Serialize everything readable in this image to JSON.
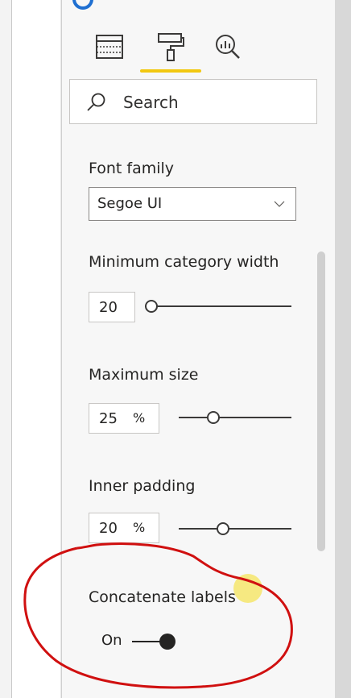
{
  "tabs": [
    {
      "name": "fields",
      "icon": "table-icon"
    },
    {
      "name": "format",
      "icon": "paint-roller-icon",
      "active": true
    },
    {
      "name": "analytics",
      "icon": "analytics-magnifier-icon"
    }
  ],
  "accent_color": "#f2c811",
  "search": {
    "placeholder": "Search",
    "icon": "search-icon"
  },
  "font_family": {
    "label": "Font family",
    "value": "Segoe UI"
  },
  "min_category_width": {
    "label": "Minimum category width",
    "value": "20",
    "slider_fraction": 0.0
  },
  "maximum_size": {
    "label": "Maximum size",
    "value": "25",
    "unit": "%",
    "slider_fraction": 0.28
  },
  "inner_padding": {
    "label": "Inner padding",
    "value": "20",
    "unit": "%",
    "slider_fraction": 0.38
  },
  "concatenate_labels": {
    "label": "Concatenate labels",
    "state": "On",
    "on": true
  },
  "annotation_color": "#d01010"
}
